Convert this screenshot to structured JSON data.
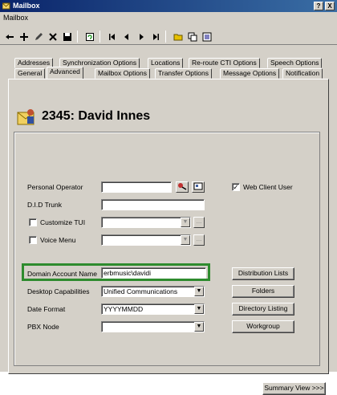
{
  "window": {
    "title": "Mailbox"
  },
  "menu": {
    "items": [
      "Mailbox"
    ]
  },
  "toolbar": {
    "buttons": [
      "pointer-icon",
      "add-icon",
      "edit-icon",
      "delete-icon",
      "save-icon",
      "refresh-icon",
      "first-record-icon",
      "previous-record-icon",
      "next-record-icon",
      "last-record-icon",
      "folder-icon",
      "copy-icon",
      "list-icon"
    ]
  },
  "tabs": {
    "row1": [
      "Addresses",
      "Synchronization Options",
      "Locations",
      "Re-route CTI Options",
      "Speech Options"
    ],
    "row2": [
      "General",
      "Advanced",
      "Mailbox Options",
      "Transfer Options",
      "Message Options",
      "Notification"
    ],
    "active": "Advanced"
  },
  "header": {
    "mailbox_title": "2345: David Innes"
  },
  "form": {
    "personal_operator_label": "Personal Operator",
    "did_trunk_label": "D.I.D Trunk",
    "customize_tui_label": "Customize TUI",
    "voice_menu_label": "Voice Menu",
    "web_client_label": "Web Client User",
    "web_client_checked": true,
    "domain_label": "Domain Account Name",
    "domain_value": "erbmusic\\davidi",
    "desktop_label": "Desktop Capabilities",
    "desktop_value": "Unified Communications",
    "date_label": "Date Format",
    "date_value": "YYYYMMDD",
    "pbx_label": "PBX Node",
    "pbx_value": ""
  },
  "buttons": {
    "distribution_lists": "Distribution Lists",
    "folders": "Folders",
    "directory_listing": "Directory Listing",
    "workgroup": "Workgroup",
    "summary_view": "Summary View >>>",
    "title_help": "?",
    "title_close": "X",
    "ellipsis": "..."
  },
  "colors": {
    "highlight": "#2e8b2e",
    "title_bar": "#0a246a"
  }
}
